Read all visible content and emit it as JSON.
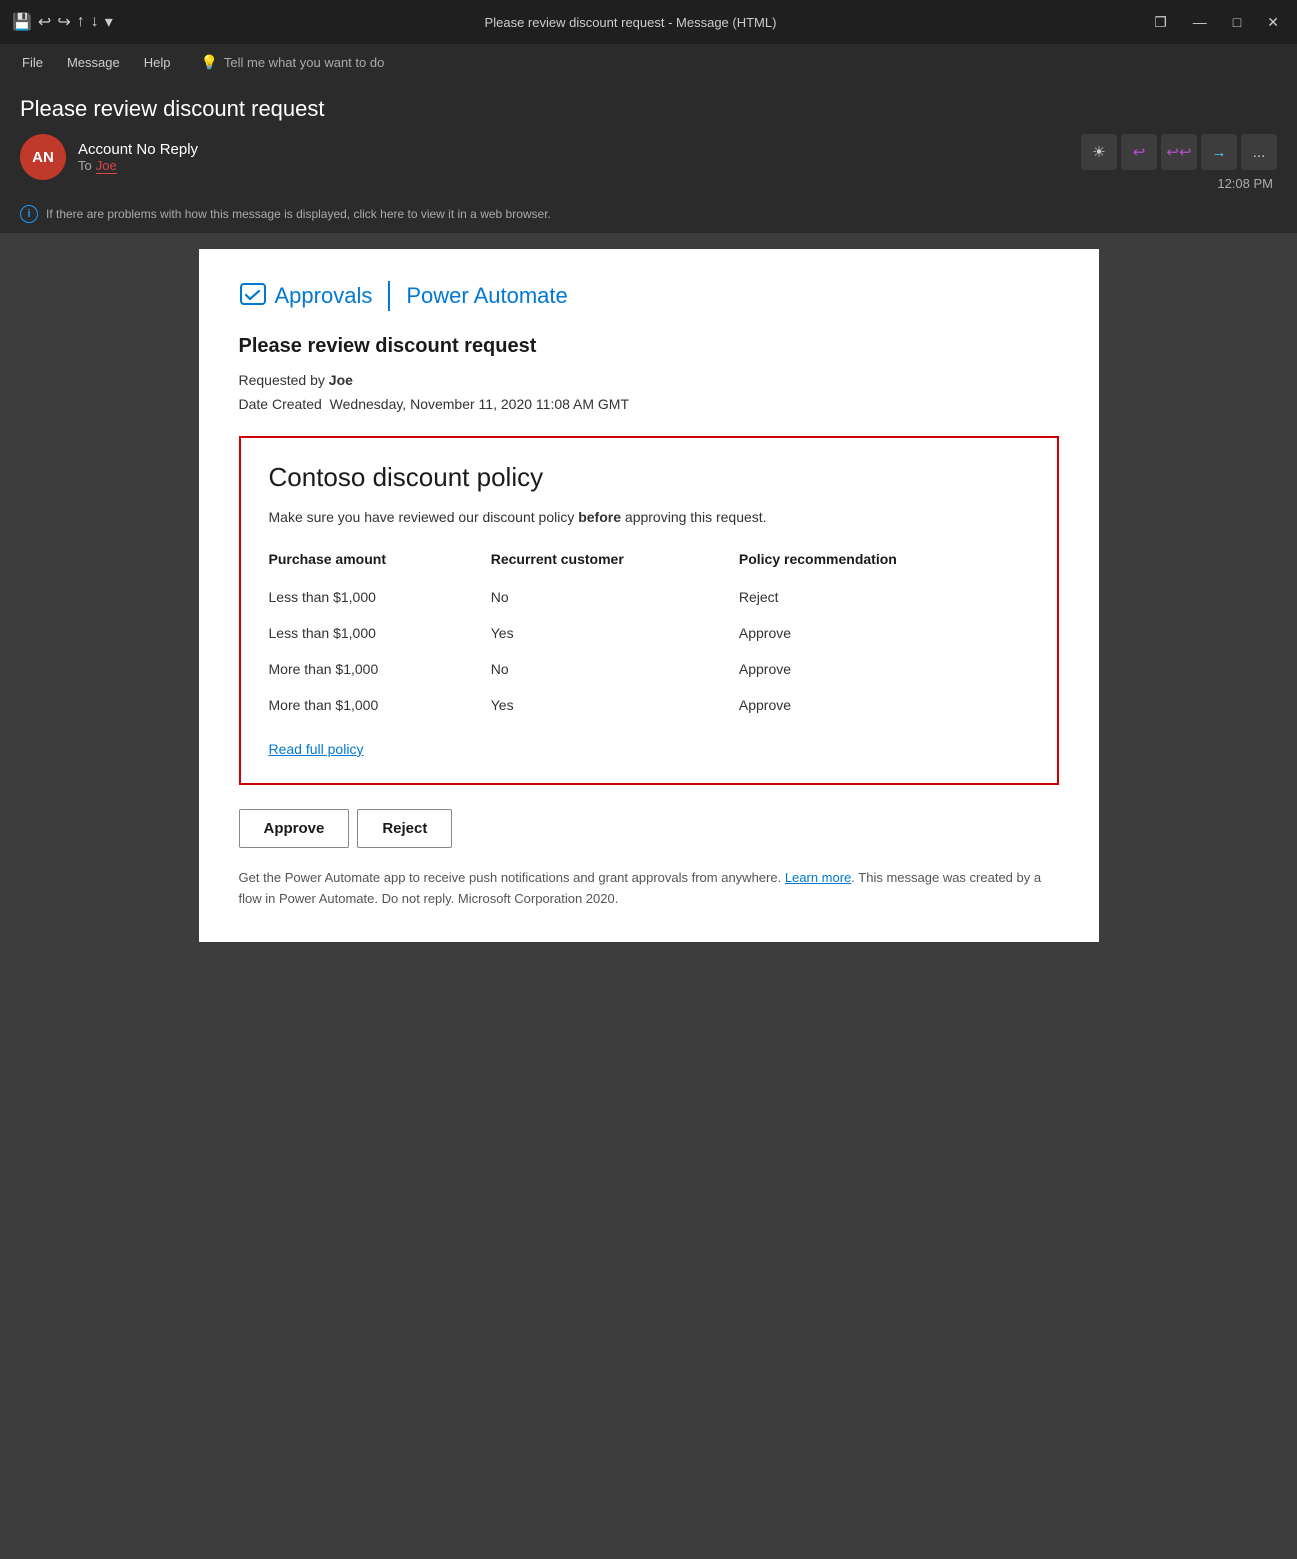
{
  "titlebar": {
    "title": "Please review discount request  -  Message (HTML)",
    "icons": {
      "save": "💾",
      "undo": "↩",
      "redo": "↪",
      "up": "↑",
      "down": "↓",
      "dropdown": "▾"
    },
    "window_controls": {
      "restore": "❐",
      "minimize": "—",
      "maximize": "□",
      "close": "✕"
    }
  },
  "menubar": {
    "items": [
      "File",
      "Message",
      "Help"
    ],
    "search_placeholder": "Tell me what you want to do"
  },
  "email": {
    "subject": "Please review discount request",
    "sender_initials": "AN",
    "sender_name": "Account No Reply",
    "to_label": "To",
    "to_name": "Joe",
    "timestamp": "12:08 PM",
    "action_buttons": {
      "sun": "☀",
      "reply_back": "↩",
      "reply_all": "↩↩",
      "forward": "→",
      "more": "..."
    },
    "info_message": "If there are problems with how this message is displayed, click here to view it in a web browser."
  },
  "content": {
    "approvals_label": "Approvals",
    "divider": "|",
    "power_automate_label": "Power Automate",
    "email_title": "Please review discount request",
    "requested_by_label": "Requested by",
    "requested_by_name": "Joe",
    "date_created_label": "Date Created",
    "date_created_value": "Wednesday, November 11, 2020 11:08 AM GMT",
    "policy": {
      "title": "Contoso discount policy",
      "description_start": "Make sure you have reviewed our discount policy ",
      "description_bold": "before",
      "description_end": " approving this request.",
      "table_headers": [
        "Purchase amount",
        "Recurrent customer",
        "Policy recommendation"
      ],
      "table_rows": [
        [
          "Less than $1,000",
          "No",
          "Reject"
        ],
        [
          "Less than $1,000",
          "Yes",
          "Approve"
        ],
        [
          "More than $1,000",
          "No",
          "Approve"
        ],
        [
          "More than $1,000",
          "Yes",
          "Approve"
        ]
      ],
      "read_full_policy": "Read full policy"
    },
    "approve_button": "Approve",
    "reject_button": "Reject",
    "footer": {
      "text_start": "Get the Power Automate app to receive push notifications and grant approvals from anywhere. ",
      "learn_more_link": "Learn more",
      "text_end": ". This message was created by a flow in Power Automate. Do not reply. Microsoft Corporation 2020."
    }
  }
}
